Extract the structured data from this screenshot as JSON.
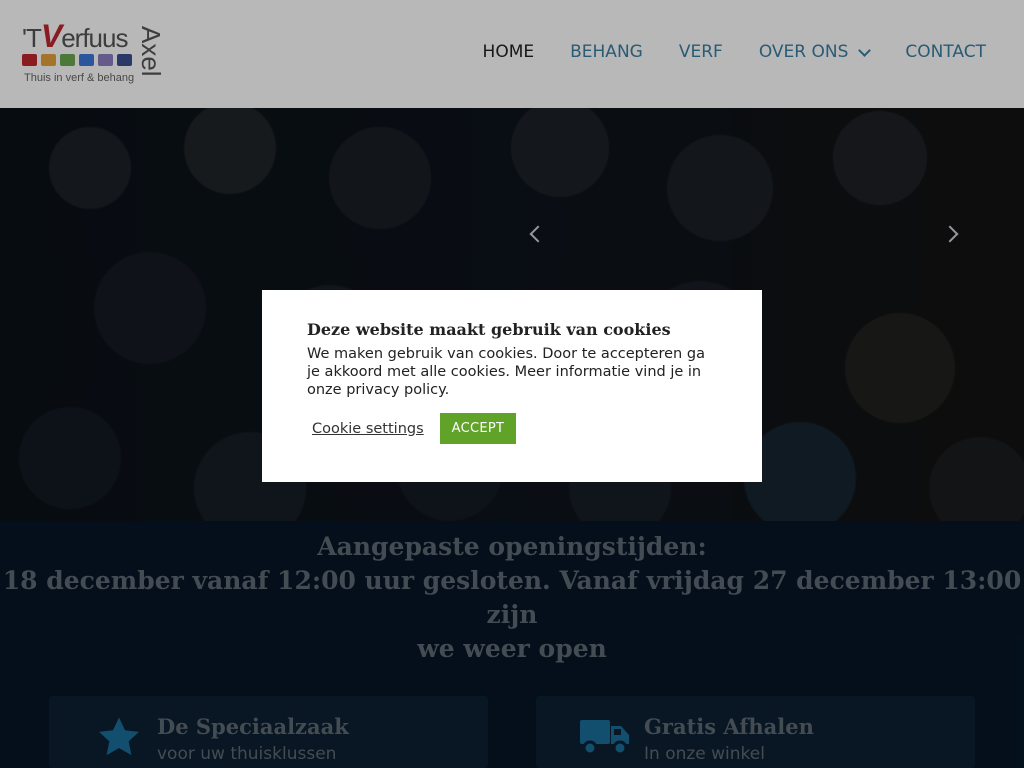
{
  "logo": {
    "main_prefix": "'T",
    "main_v": "V",
    "main_suffix": "erfuus",
    "side": "Axel",
    "tagline": "Thuis in verf & behang",
    "swatch_colors": [
      "#c0262d",
      "#e2a13a",
      "#6aa84f",
      "#3c78d8",
      "#8e7cc3",
      "#3b4f8f"
    ]
  },
  "nav": {
    "items": [
      {
        "label": "HOME",
        "active": true
      },
      {
        "label": "BEHANG",
        "active": false
      },
      {
        "label": "VERF",
        "active": false
      },
      {
        "label": "OVER ONS",
        "active": false,
        "has_dropdown": true
      },
      {
        "label": "CONTACT",
        "active": false
      }
    ]
  },
  "slider": {
    "prev_icon": "chevron-left-icon",
    "next_icon": "chevron-right-icon"
  },
  "notice": {
    "line1": "Aangepaste openingstijden:",
    "line2": "18 december vanaf 12:00 uur gesloten. Vanaf vrijdag 27 december 13:00 zijn",
    "line3": "we weer open"
  },
  "features": [
    {
      "icon": "star-icon",
      "title": "De Speciaalzaak",
      "subtitle": "voor uw thuisklussen"
    },
    {
      "icon": "truck-icon",
      "title": "Gratis Afhalen",
      "subtitle": "In onze winkel"
    }
  ],
  "cookie_modal": {
    "title": "Deze website maakt gebruik van cookies",
    "body": "We maken gebruik van cookies. Door te accepteren ga je akkoord met alle cookies. Meer informatie vind je in onze privacy policy.",
    "settings_label": "Cookie settings",
    "accept_label": "ACCEPT"
  },
  "colors": {
    "nav_link": "#3b7ea1",
    "accept": "#61a229",
    "dark_bg": "#061626"
  }
}
